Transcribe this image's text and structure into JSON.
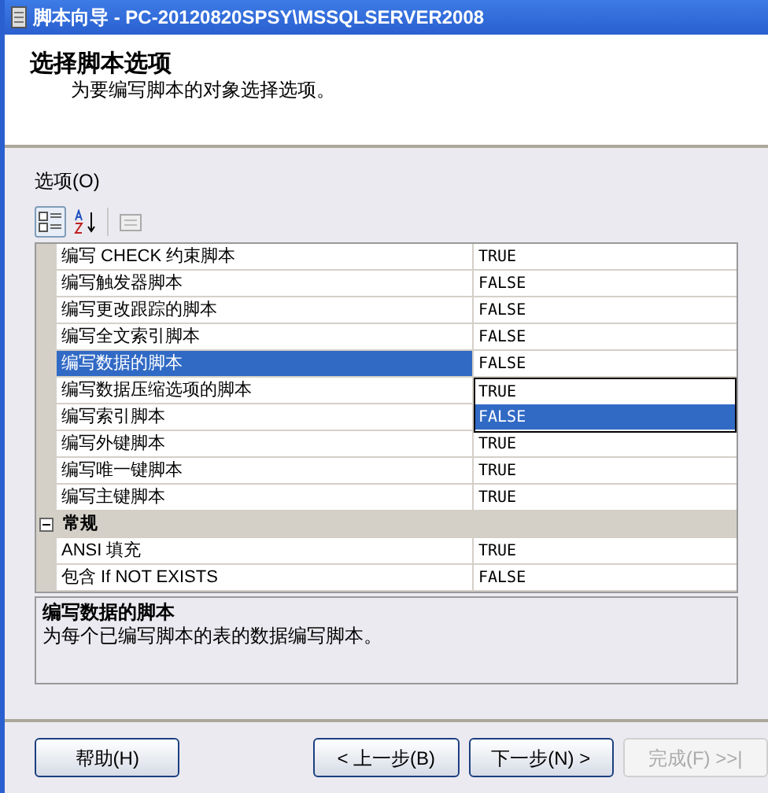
{
  "window": {
    "title": "脚本向导 - PC-20120820SPSY\\MSSQLSERVER2008"
  },
  "header": {
    "title": "选择脚本选项",
    "subtitle": "为要编写脚本的对象选择选项。"
  },
  "options_label": "选项(O)",
  "toolbar": [
    {
      "kind": "categorized",
      "selected": true
    },
    {
      "kind": "alphabetical",
      "selected": false
    },
    {
      "kind": "pages",
      "selected": false
    }
  ],
  "grid": {
    "groups": [
      {
        "rows": [
          {
            "name": "编写 CHECK 约束脚本",
            "value": "TRUE",
            "selected": false
          },
          {
            "name": "编写触发器脚本",
            "value": "FALSE",
            "selected": false
          },
          {
            "name": "编写更改跟踪的脚本",
            "value": "FALSE",
            "selected": false
          },
          {
            "name": "编写全文索引脚本",
            "value": "FALSE",
            "selected": false
          },
          {
            "name": "编写数据的脚本",
            "value": "FALSE",
            "selected": true,
            "dropdown": [
              {
                "label": "TRUE",
                "selected": false
              },
              {
                "label": "FALSE",
                "selected": true
              }
            ]
          },
          {
            "name": "编写数据压缩选项的脚本",
            "selected": false
          },
          {
            "name": "编写索引脚本",
            "selected": false
          },
          {
            "name": "编写外键脚本",
            "value": "TRUE",
            "selected": false
          },
          {
            "name": "编写唯一键脚本",
            "value": "TRUE",
            "selected": false
          },
          {
            "name": "编写主键脚本",
            "value": "TRUE",
            "selected": false
          }
        ]
      },
      {
        "name": "常规",
        "expanded": true,
        "rows": [
          {
            "name": "ANSI 填充",
            "value": "TRUE",
            "selected": false
          },
          {
            "name": "包含 If NOT EXISTS",
            "value": "FALSE",
            "selected": false
          }
        ]
      }
    ]
  },
  "description": {
    "title": "编写数据的脚本",
    "text": "为每个已编写脚本的表的数据编写脚本。"
  },
  "buttons": [
    {
      "label": "帮助(H)",
      "disabled": false
    },
    {
      "label": "< 上一步(B)",
      "disabled": false
    },
    {
      "label": "下一步(N) >",
      "disabled": false
    },
    {
      "label": "完成(F) >>|",
      "disabled": true
    }
  ]
}
